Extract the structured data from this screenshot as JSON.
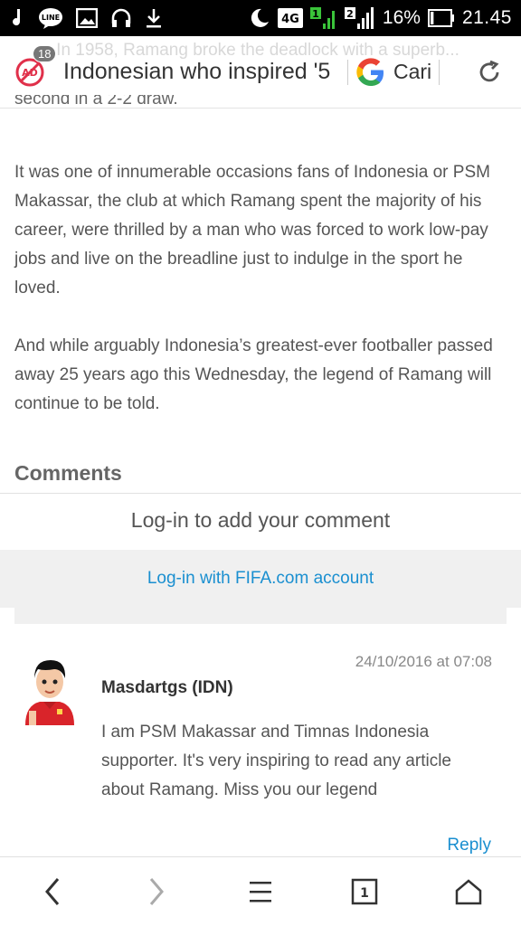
{
  "status_bar": {
    "network": "4G",
    "sim_badge": "2",
    "battery": "16%",
    "time": "21.45",
    "icons": [
      "music-note-icon",
      "line-app-icon",
      "image-icon",
      "headphones-icon",
      "download-icon",
      "moon-icon",
      "signal-icon",
      "battery-icon"
    ]
  },
  "browser": {
    "ghost_text": "...-In 1958, Ramang broke the deadlock with a superb...",
    "adblock_count": "18",
    "page_title": "Indonesian who inspired '5",
    "search_label": "Cari"
  },
  "article": {
    "clipped_line": "second in a 2-2 draw.",
    "paragraphs": [
      "It was one of innumerable occasions fans of Indonesia or PSM Makassar, the club at which Ramang spent the majority of his career, were thrilled by a man who was forced to work low-pay jobs and live on the breadline just to indulge in the sport he loved.",
      "And while arguably Indonesia’s greatest-ever footballer passed away 25 years ago this Wednesday, the legend of Ramang will continue to be told."
    ]
  },
  "comments": {
    "heading": "Comments",
    "login_prompt": "Log-in to add your comment",
    "login_link": "Log-in with FIFA.com account",
    "items": [
      {
        "date": "24/10/2016 at 07:08",
        "author": "Masdartgs (IDN)",
        "body": "I am PSM Makassar and Timnas Indonesia supporter. It's very inspiring to read any article about Ramang. Miss you our legend",
        "reply_label": "Reply"
      }
    ]
  },
  "nav": {
    "tab_count": "1",
    "icons": [
      "back-icon",
      "forward-icon",
      "menu-icon",
      "tabs-icon",
      "home-icon"
    ]
  },
  "colors": {
    "link": "#1a8fd0",
    "adblock": "#e0304a",
    "band": "#f0f0f0"
  }
}
